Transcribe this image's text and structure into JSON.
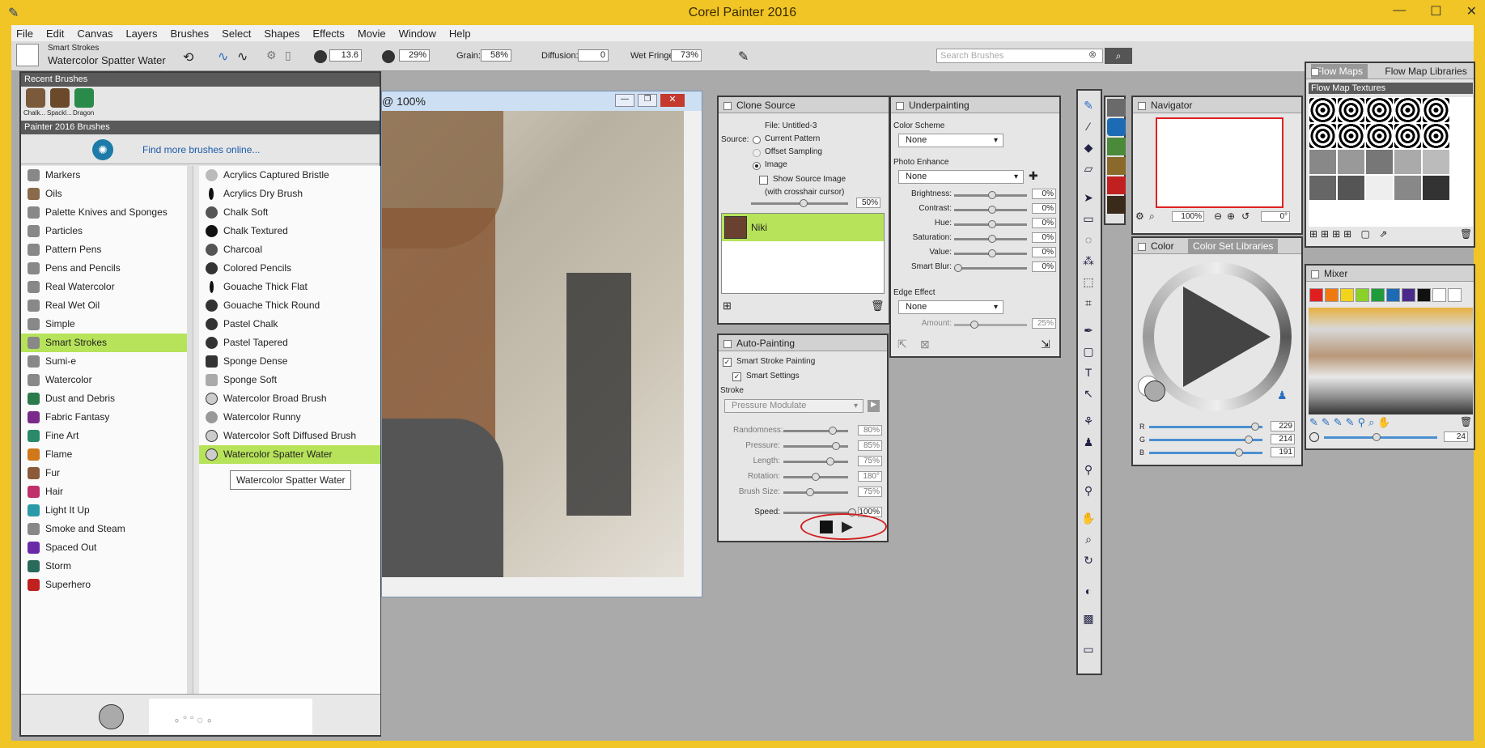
{
  "app": {
    "title": "Corel Painter 2016"
  },
  "window_buttons": [
    "—",
    "☐",
    "✕"
  ],
  "menu": [
    "File",
    "Edit",
    "Canvas",
    "Layers",
    "Brushes",
    "Select",
    "Shapes",
    "Effects",
    "Movie",
    "Window",
    "Help"
  ],
  "propbar": {
    "category": "Smart Strokes",
    "variant": "Watercolor Spatter Water",
    "size": "13.6",
    "opacity": "29%",
    "grain_label": "Grain:",
    "grain": "58%",
    "diffusion_label": "Diffusion:",
    "diffusion": "0",
    "wetfringe_label": "Wet Fringe:",
    "wetfringe": "73%"
  },
  "search": {
    "placeholder": "Search Brushes"
  },
  "brush_library": {
    "recent_title": "Recent Brushes",
    "recent": [
      "Chalk...",
      "Spackl...",
      "Dragon"
    ],
    "library_title": "Painter 2016 Brushes",
    "find_more": "Find more brushes online...",
    "categories": [
      "Markers",
      "Oils",
      "Palette Knives and Sponges",
      "Particles",
      "Pattern Pens",
      "Pens and Pencils",
      "Real Watercolor",
      "Real Wet Oil",
      "Simple",
      "Smart Strokes",
      "Sumi-e",
      "Watercolor",
      "Dust and Debris",
      "Fabric Fantasy",
      "Fine Art",
      "Flame",
      "Fur",
      "Hair",
      "Light It Up",
      "Smoke and Steam",
      "Spaced Out",
      "Storm",
      "Superhero"
    ],
    "selected_category": "Smart Strokes",
    "variants": [
      "Acrylics Captured Bristle",
      "Acrylics Dry Brush",
      "Chalk Soft",
      "Chalk Textured",
      "Charcoal",
      "Colored Pencils",
      "Gouache Thick Flat",
      "Gouache Thick Round",
      "Pastel Chalk",
      "Pastel Tapered",
      "Sponge Dense",
      "Sponge Soft",
      "Watercolor Broad Brush",
      "Watercolor Runny",
      "Watercolor Soft Diffused Brush",
      "Watercolor Spatter Water"
    ],
    "selected_variant": "Watercolor Spatter Water",
    "tooltip": "Watercolor Spatter Water"
  },
  "document": {
    "title": "@ 100%"
  },
  "clone_source": {
    "title": "Clone Source",
    "file": "File: Untitled-3",
    "source_label": "Source:",
    "options": [
      "Current Pattern",
      "Offset Sampling",
      "Image"
    ],
    "show_source": "Show Source Image",
    "crosshair": "(with crosshair cursor)",
    "opacity": "50%",
    "item": "Niki"
  },
  "auto_painting": {
    "title": "Auto-Painting",
    "smart_stroke": "Smart Stroke Painting",
    "smart_settings": "Smart Settings",
    "stroke_label": "Stroke",
    "stroke_value": "Pressure Modulate",
    "params": [
      {
        "label": "Randomness:",
        "value": "80%",
        "level": 0.8
      },
      {
        "label": "Pressure:",
        "value": "85%",
        "level": 0.85
      },
      {
        "label": "Length:",
        "value": "75%",
        "level": 0.75
      },
      {
        "label": "Rotation:",
        "value": "180°",
        "level": 0.5
      },
      {
        "label": "Brush Size:",
        "value": "75%",
        "level": 0.4
      }
    ],
    "speed_label": "Speed:",
    "speed": "100%"
  },
  "underpainting": {
    "title": "Underpainting",
    "scheme_label": "Color Scheme",
    "scheme": "None",
    "enhance_label": "Photo Enhance",
    "enhance": "None",
    "params": [
      {
        "label": "Brightness:",
        "value": "0%"
      },
      {
        "label": "Contrast:",
        "value": "0%"
      },
      {
        "label": "Hue:",
        "value": "0%"
      },
      {
        "label": "Saturation:",
        "value": "0%"
      },
      {
        "label": "Value:",
        "value": "0%"
      },
      {
        "label": "Smart Blur:",
        "value": "0%"
      }
    ],
    "edge_label": "Edge Effect",
    "edge": "None",
    "amount_label": "Amount:",
    "amount": "25%"
  },
  "navigator": {
    "title": "Navigator",
    "zoom": "100%",
    "rotation": "0°"
  },
  "color": {
    "tab1": "Color",
    "tab2": "Color Set Libraries",
    "r": "229",
    "g": "214",
    "b": "191",
    "r_label": "R",
    "g_label": "G",
    "b_label": "B"
  },
  "flow_maps": {
    "tab1": "Flow Maps",
    "tab2": "Flow Map Libraries",
    "section": "Flow Map Textures"
  },
  "mixer": {
    "title": "Mixer",
    "size": "24",
    "swatches": [
      "#e02020",
      "#f07a10",
      "#f2d41a",
      "#8ad12a",
      "#1e9b3a",
      "#1e6bb5",
      "#4a2a8a",
      "#111111",
      "#ffffff",
      "#ffffff"
    ]
  }
}
